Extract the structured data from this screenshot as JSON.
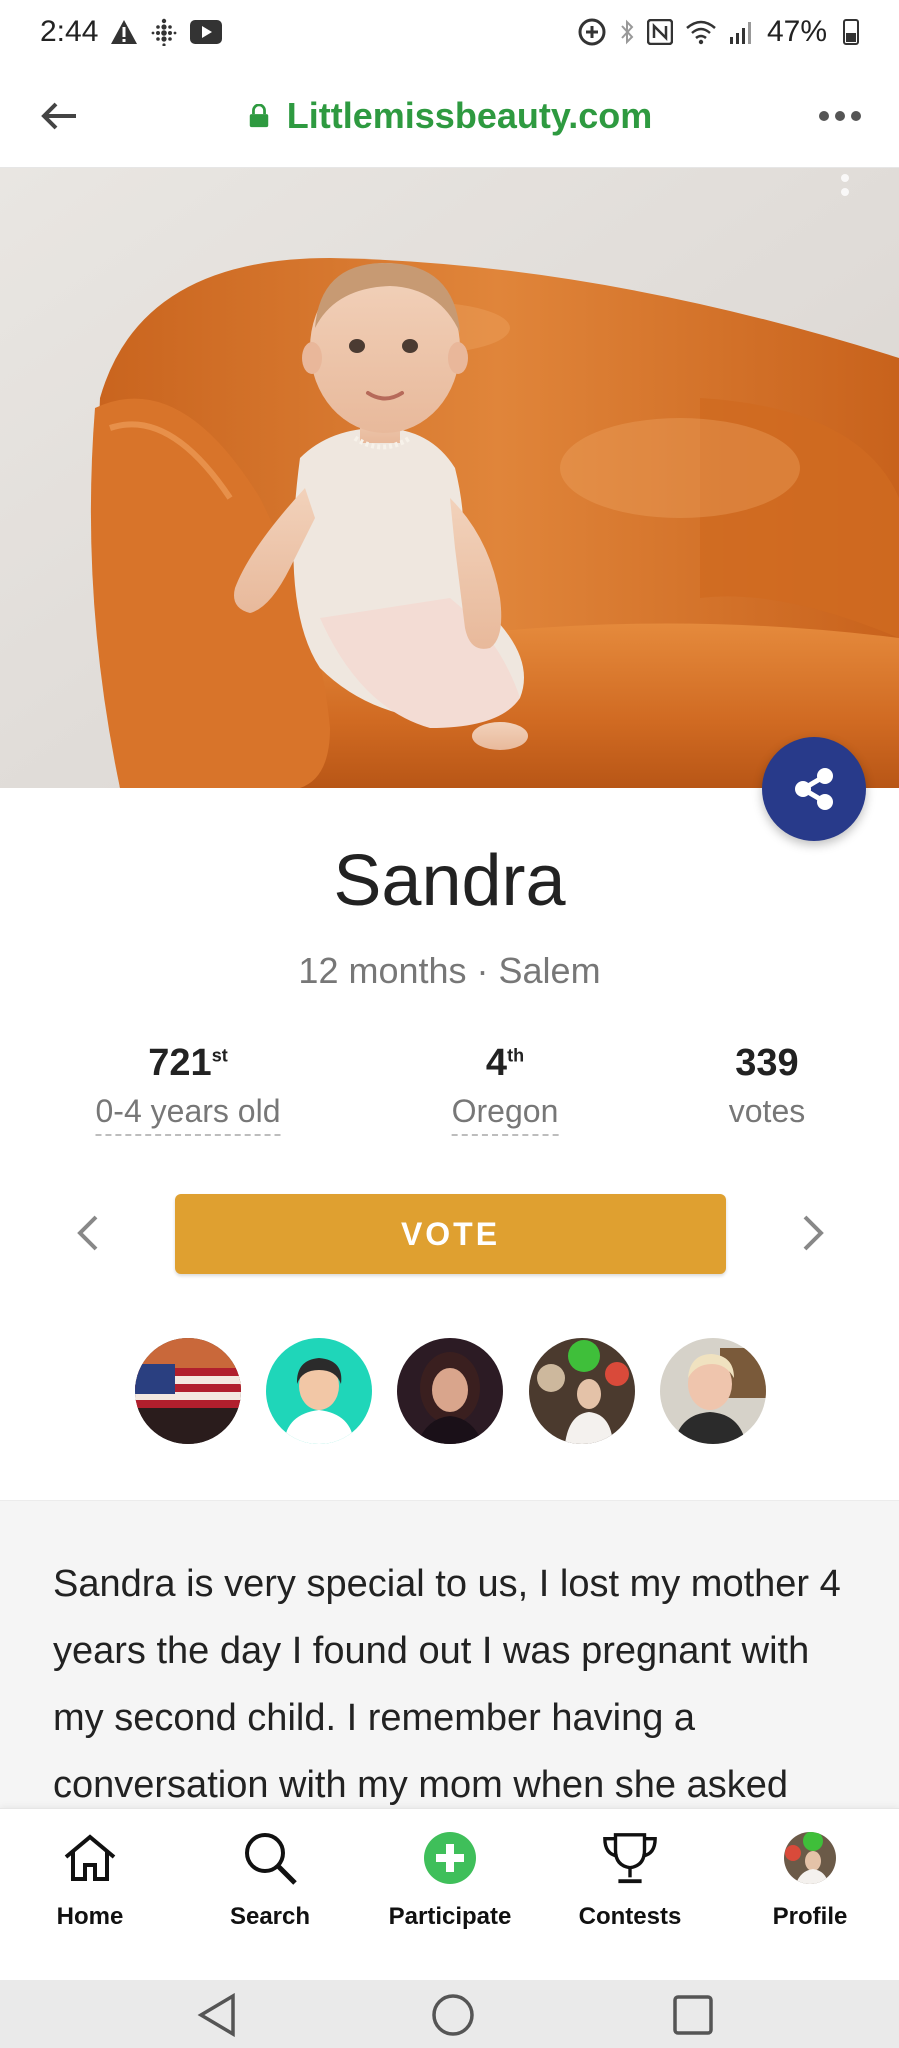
{
  "status_bar": {
    "time": "2:44",
    "battery": "47%",
    "icons": [
      "alert-icon",
      "fitbit-icon",
      "youtube-icon",
      "data-saver-icon",
      "bluetooth-icon",
      "nfc-icon",
      "wifi-icon",
      "signal-icon",
      "battery-icon"
    ]
  },
  "browser": {
    "url": "Littlemissbeauty.com",
    "back_icon": "arrow-left-icon",
    "more_icon": "more-dots-icon",
    "lock_icon": "lock-icon",
    "accent": "#2e9a40"
  },
  "profile": {
    "name": "Sandra",
    "subtitle": "12 months · Salem",
    "stats": [
      {
        "value": "721",
        "suffix": "st",
        "label": "0-4 years old"
      },
      {
        "value": "4",
        "suffix": "th",
        "label": "Oregon"
      },
      {
        "value": "339",
        "suffix": "",
        "label": "votes"
      }
    ]
  },
  "actions": {
    "vote_label": "VOTE",
    "vote_color": "#dfa030",
    "share_color": "#283a8a"
  },
  "voters": [
    {
      "name": "voter-flag-avatar"
    },
    {
      "name": "voter-default-avatar"
    },
    {
      "name": "voter-photo-avatar"
    },
    {
      "name": "voter-balloons-avatar"
    },
    {
      "name": "voter-woman-avatar"
    }
  ],
  "story": {
    "text": "Sandra is very special to us, I lost my mother 4 years the day I found out I was pregnant with my second child. I remember having a conversation with my mom when she asked"
  },
  "bottom_nav": [
    {
      "label": "Home",
      "icon": "home-icon"
    },
    {
      "label": "Search",
      "icon": "search-icon"
    },
    {
      "label": "Participate",
      "icon": "plus-circle-icon"
    },
    {
      "label": "Contests",
      "icon": "trophy-icon"
    },
    {
      "label": "Profile",
      "icon": "profile-avatar-icon"
    }
  ],
  "system_nav": [
    "back-triangle-icon",
    "home-circle-icon",
    "recents-square-icon"
  ]
}
